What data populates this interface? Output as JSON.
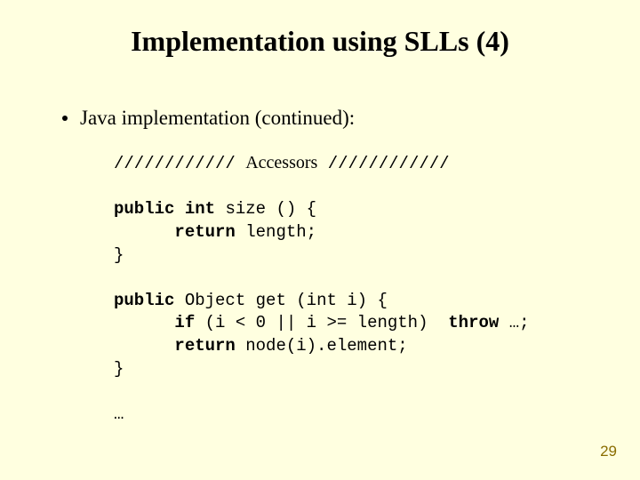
{
  "title": "Implementation using SLLs (4)",
  "bullet": "Java implementation (continued):",
  "code": {
    "slashes": "////////////",
    "accessors_label": "Accessors",
    "kw_public": "public",
    "kw_int": "int",
    "kw_return": "return",
    "kw_if": "if",
    "kw_throw": "throw",
    "kw_object": "Object",
    "size_sig_tail": " size () {",
    "size_ret_tail": " length;",
    "get_sig_tail": " get (int i) {",
    "get_if_tail": " (i < 0 || i >= length)  ",
    "throw_tail": " …;",
    "get_ret_tail": " node(i).element;",
    "brace_close": "}",
    "ellipsis": "…"
  },
  "page_number": "29"
}
